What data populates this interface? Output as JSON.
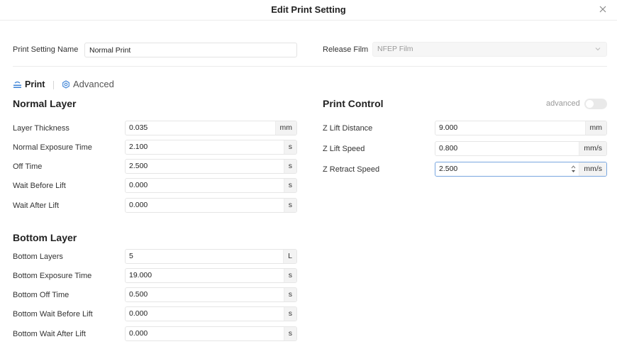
{
  "dialog": {
    "title": "Edit Print Setting",
    "close_icon": "close-icon"
  },
  "header": {
    "name_label": "Print Setting Name",
    "name_value": "Normal Print",
    "release_label": "Release Film",
    "release_value": "NFEP Film"
  },
  "tabs": [
    {
      "label": "Print",
      "icon": "print-layer-icon",
      "active": true
    },
    {
      "label": "Advanced",
      "icon": "advanced-gear-icon",
      "active": false
    }
  ],
  "normal_layer": {
    "title": "Normal Layer",
    "rows": [
      {
        "label": "Layer Thickness",
        "value": "0.035",
        "unit": "mm"
      },
      {
        "label": "Normal Exposure Time",
        "value": "2.100",
        "unit": "s"
      },
      {
        "label": "Off Time",
        "value": "2.500",
        "unit": "s"
      },
      {
        "label": "Wait Before Lift",
        "value": "0.000",
        "unit": "s"
      },
      {
        "label": "Wait After Lift",
        "value": "0.000",
        "unit": "s"
      }
    ]
  },
  "bottom_layer": {
    "title": "Bottom Layer",
    "rows": [
      {
        "label": "Bottom Layers",
        "value": "5",
        "unit": "L"
      },
      {
        "label": "Bottom Exposure Time",
        "value": "19.000",
        "unit": "s"
      },
      {
        "label": "Bottom Off Time",
        "value": "0.500",
        "unit": "s"
      },
      {
        "label": "Bottom Wait Before Lift",
        "value": "0.000",
        "unit": "s"
      },
      {
        "label": "Bottom Wait After Lift",
        "value": "0.000",
        "unit": "s"
      }
    ]
  },
  "print_control": {
    "title": "Print Control",
    "toggle_label": "advanced",
    "toggle_on": false,
    "rows": [
      {
        "label": "Z Lift Distance",
        "value": "9.000",
        "unit": "mm"
      },
      {
        "label": "Z Lift Speed",
        "value": "0.800",
        "unit": "mm/s"
      },
      {
        "label": "Z Retract Speed",
        "value": "2.500",
        "unit": "mm/s"
      }
    ]
  },
  "colors": {
    "accent": "#3b82d6",
    "focus_border": "#7aa7e0",
    "unit_bg": "#f3f3f3"
  }
}
